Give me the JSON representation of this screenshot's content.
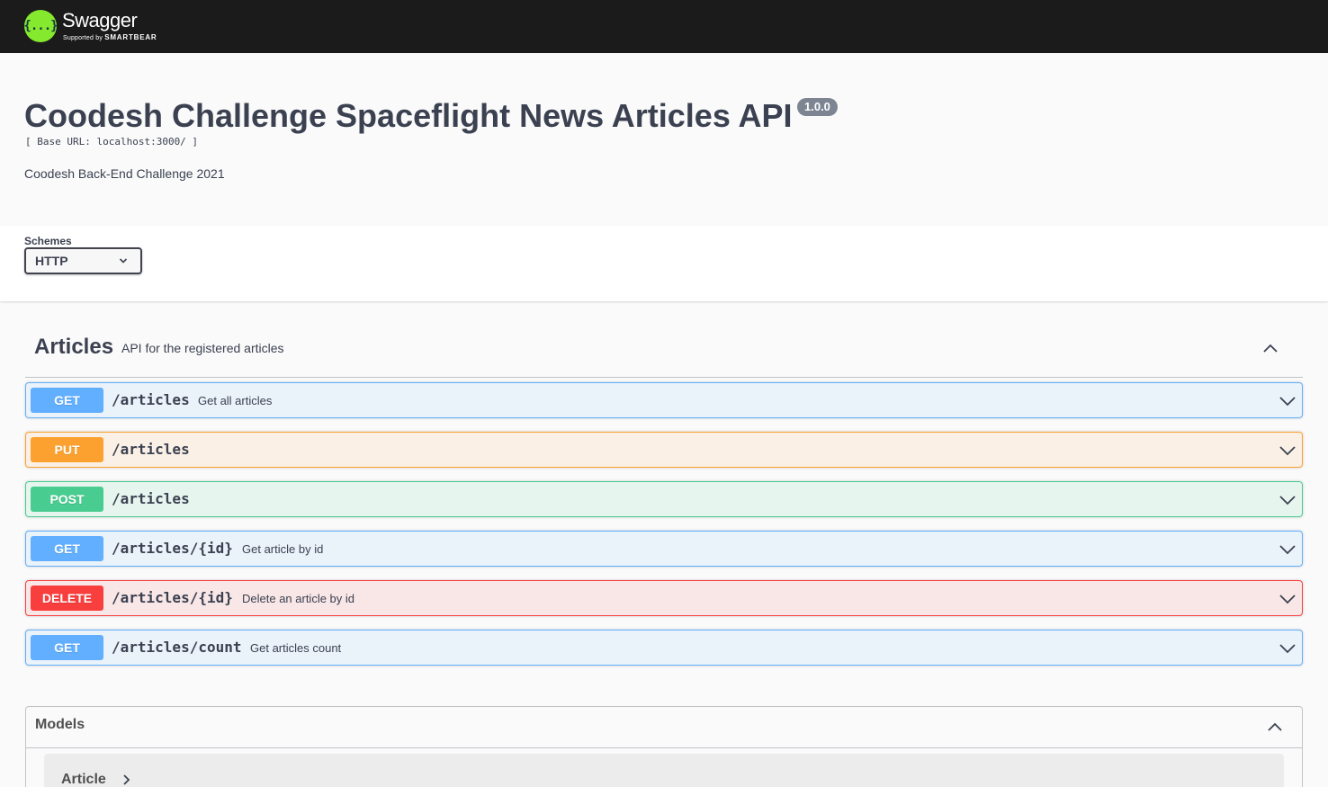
{
  "topbar": {
    "logo_glyph": "{...}",
    "logo_name": "Swagger",
    "logo_sub_prefix": "Supported by",
    "logo_sub_brand": "SMARTBEAR"
  },
  "info": {
    "title": "Coodesh Challenge Spaceflight News Articles API",
    "version": "1.0.0",
    "base_url": "[ Base URL: localhost:3000/ ]",
    "description": "Coodesh Back-End Challenge 2021"
  },
  "schemes": {
    "label": "Schemes",
    "selected": "HTTP"
  },
  "tag": {
    "name": "Articles",
    "description": "API for the registered articles"
  },
  "operations": [
    {
      "method": "GET",
      "path": "/articles",
      "summary": "Get all articles"
    },
    {
      "method": "PUT",
      "path": "/articles",
      "summary": ""
    },
    {
      "method": "POST",
      "path": "/articles",
      "summary": ""
    },
    {
      "method": "GET",
      "path": "/articles/{id}",
      "summary": "Get article by id"
    },
    {
      "method": "DELETE",
      "path": "/articles/{id}",
      "summary": "Delete an article by id"
    },
    {
      "method": "GET",
      "path": "/articles/count",
      "summary": "Get articles count"
    }
  ],
  "models": {
    "title": "Models",
    "items": [
      {
        "name": "Article"
      }
    ]
  },
  "colors": {
    "get": "#61affe",
    "put": "#fca130",
    "post": "#49cc90",
    "delete": "#f93e3e",
    "topbar": "#1b1b1b",
    "logo": "#85ea2d"
  }
}
